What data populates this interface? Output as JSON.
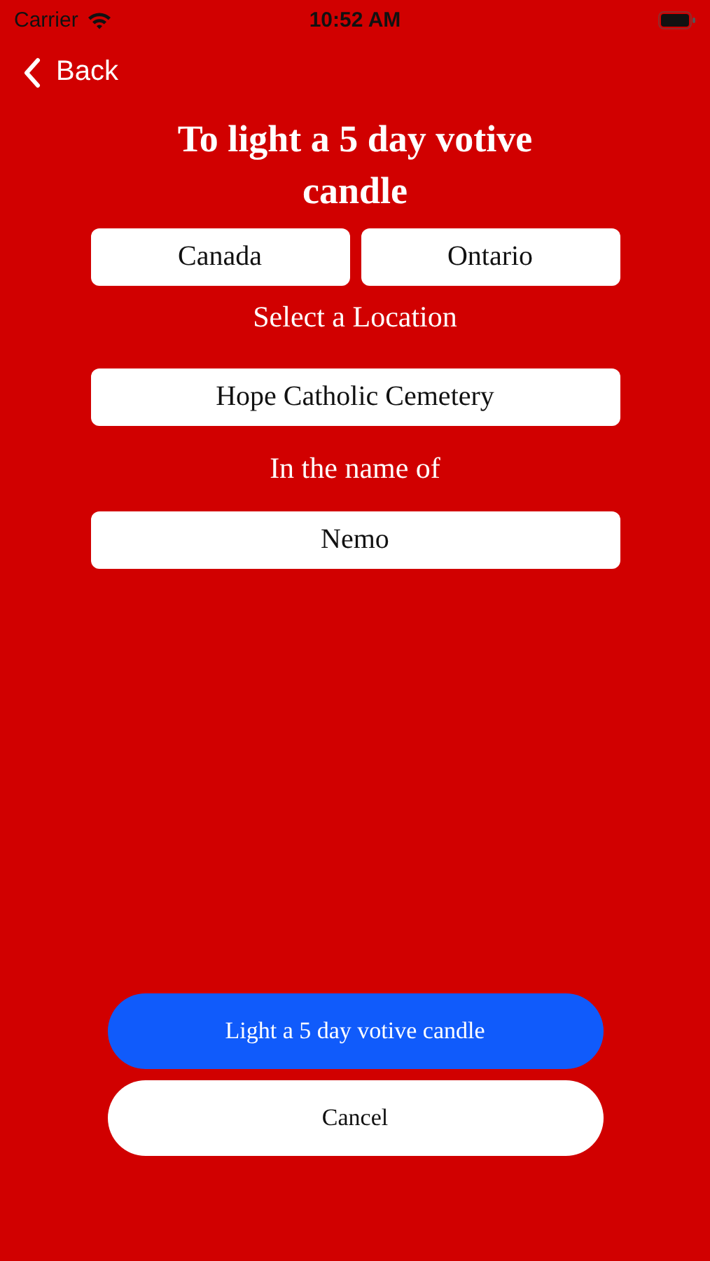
{
  "status_bar": {
    "carrier": "Carrier",
    "time": "10:52 AM"
  },
  "nav": {
    "back_label": "Back"
  },
  "title": "To light a 5 day votive candle",
  "country": "Canada",
  "region": "Ontario",
  "location_label": "Select a Location",
  "location": "Hope Catholic Cemetery",
  "name_label": "In the name of",
  "name_field": {
    "value": "Nemo"
  },
  "buttons": [
    {
      "label": "Light a 5 day votive candle",
      "kind": "primary"
    },
    {
      "label": "Cancel",
      "kind": "secondary"
    }
  ]
}
